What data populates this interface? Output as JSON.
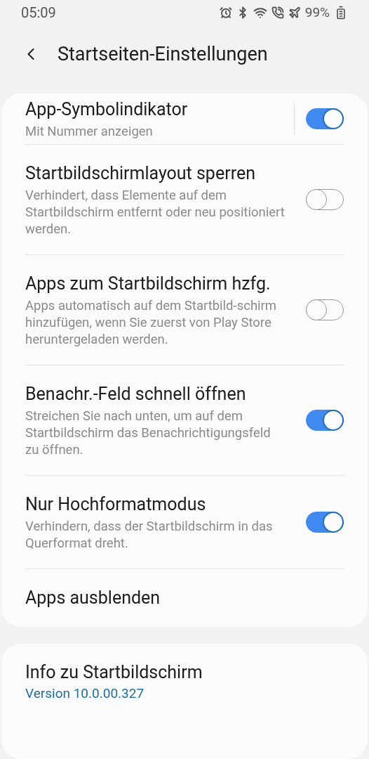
{
  "status_bar": {
    "time": "05:09",
    "battery": "99%"
  },
  "header": {
    "title": "Startseiten-Einstellungen"
  },
  "settings": [
    {
      "kind": "toggle",
      "title": "App-Symbolindikator",
      "subtitle": "Mit Nummer anzeigen",
      "on": true,
      "divider": true
    },
    {
      "kind": "toggle",
      "title": "Startbildschirmlayout sperren",
      "subtitle": "Verhindert, dass Elemente auf dem Startbildschirm entfernt oder neu positioniert werden.",
      "on": false
    },
    {
      "kind": "toggle",
      "title": "Apps zum Startbildschirm hzfg.",
      "subtitle": "Apps automatisch auf dem Startbild-schirm hinzufügen, wenn Sie zuerst von Play Store heruntergeladen werden.",
      "on": false
    },
    {
      "kind": "toggle",
      "title": "Benachr.-Feld schnell öffnen",
      "subtitle": "Streichen Sie nach unten, um auf dem Startbildschirm das Benachrichtigungsfeld zu öffnen.",
      "on": true
    },
    {
      "kind": "toggle",
      "title": "Nur Hochformatmodus",
      "subtitle": "Verhindern, dass der Startbildschirm in das Querformat dreht.",
      "on": true
    },
    {
      "kind": "link",
      "title": "Apps ausblenden"
    }
  ],
  "about": {
    "title": "Info zu Startbildschirm",
    "version": "Version 10.0.00.327"
  }
}
